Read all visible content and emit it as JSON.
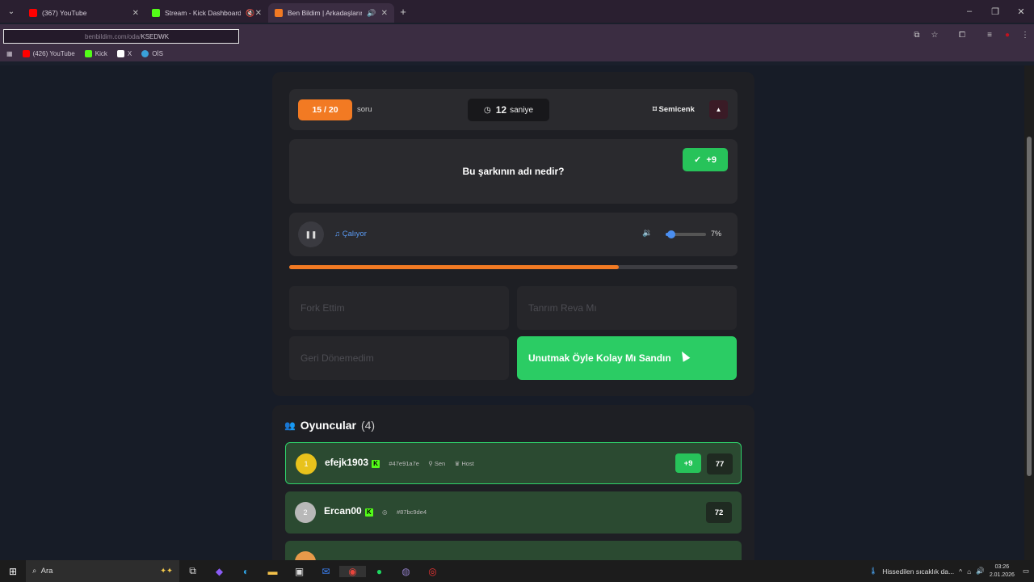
{
  "browser": {
    "tabs": [
      {
        "title": "(367) YouTube",
        "favicon_color": "#ff0000",
        "active": false
      },
      {
        "title": "Stream - Kick Dashboard",
        "favicon_color": "#53fc18",
        "active": false
      },
      {
        "title": "Ben Bildim | Arkadaşlarınla",
        "favicon_color": "#f27a23",
        "active": true
      }
    ],
    "url_host": "benbildim.com/oda/",
    "url_path": "KSEDWK",
    "bookmarks": [
      {
        "label": "(426) YouTube",
        "color": "#ff0000"
      },
      {
        "label": "Kick",
        "color": "#53fc18"
      },
      {
        "label": "X",
        "color": "#ffffff"
      },
      {
        "label": "OİS",
        "color": "#3aa0d8"
      }
    ]
  },
  "game": {
    "question_counter": "15 / 20",
    "question_counter_suffix": "soru",
    "timer_value": "12",
    "timer_unit": "saniye",
    "username": "Semicenk",
    "question_text": "Bu şarkının adı nedir?",
    "points_earned": "+9",
    "player_status": "Çalıyor",
    "volume_label": "7%",
    "volume_fraction": 0.07,
    "progress_fraction": 0.735,
    "options": [
      {
        "label": "Fork Ettim",
        "correct": false
      },
      {
        "label": "Tanrım Reva Mı",
        "correct": false
      },
      {
        "label": "Geri Dönemedim",
        "correct": false
      },
      {
        "label": "Unutmak Öyle Kolay Mı Sandın",
        "correct": true
      }
    ]
  },
  "players_panel": {
    "title": "Oyuncular",
    "count": "(4)",
    "players": [
      {
        "rank": "1",
        "name": "efejk1903",
        "hash": "#47e91a7e",
        "tags": [
          "Sen",
          "Host"
        ],
        "points": "+9",
        "score": "77",
        "rank_color": "#e8c21c"
      },
      {
        "rank": "2",
        "name": "Ercan00",
        "hash": "#87bc9de4",
        "tags": [],
        "points": "",
        "score": "72",
        "rank_color": "#b8b8b8"
      }
    ]
  },
  "taskbar": {
    "search_placeholder": "Ara",
    "weather": "Hissedilen sıcaklık da...",
    "time": "03:26",
    "date": "2.01.2026"
  }
}
